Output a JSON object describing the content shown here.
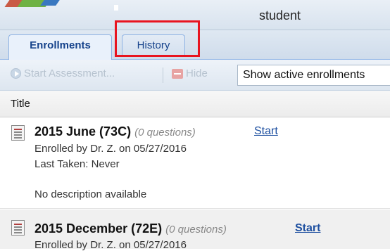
{
  "header": {
    "user_name": "student"
  },
  "tabs": [
    {
      "label": "Enrollments",
      "active": true
    },
    {
      "label": "History",
      "active": false
    }
  ],
  "toolbar": {
    "start_assessment_label": "Start Assessment...",
    "hide_label": "Hide",
    "filter_selected": "Show active enrollments"
  },
  "grid": {
    "column_title": "Title"
  },
  "enrollments": [
    {
      "title": "2015 June (73C)",
      "questions": "(0 questions)",
      "start_label": "Start",
      "enrolled_by": "Enrolled by Dr. Z. on 05/27/2016",
      "last_taken": "Last Taken: Never",
      "description": "No description available"
    },
    {
      "title": "2015 December (72E)",
      "questions": "(0 questions)",
      "start_label": "Start",
      "enrolled_by": "Enrolled by Dr. Z. on 05/27/2016"
    }
  ],
  "colors": {
    "highlight": "#e8141f",
    "tab_text": "#15428b",
    "link": "#1d4fa0"
  }
}
